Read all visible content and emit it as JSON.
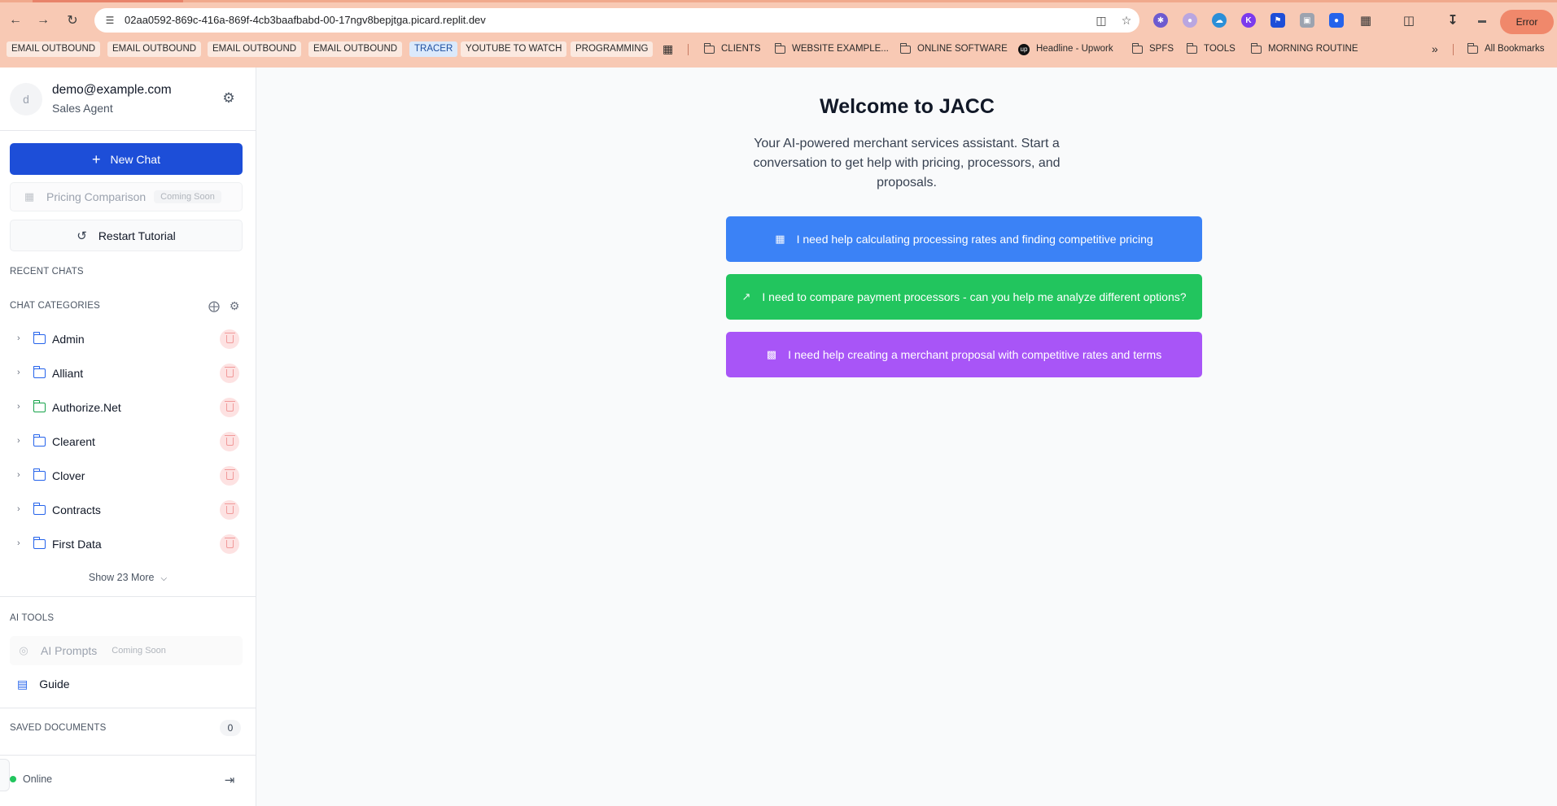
{
  "browser": {
    "url": "02aa0592-869c-416a-869f-4cb3baafbabd-00-17ngv8bepjtga.picard.replit.dev",
    "error_label": "Error",
    "bookmarks": [
      "EMAIL OUTBOUND",
      "EMAIL OUTBOUND",
      "EMAIL OUTBOUND",
      "EMAIL OUTBOUND",
      "TRACER",
      "YOUTUBE TO WATCH",
      "PROGRAMMING"
    ],
    "bookmark_folders": [
      "CLIENTS",
      "WEBSITE EXAMPLE...",
      "ONLINE SOFTWARE",
      "Headline - Upwork",
      "SPFS",
      "TOOLS",
      "MORNING ROUTINE"
    ],
    "more_label": "»",
    "all_bookmarks": "All Bookmarks"
  },
  "user": {
    "avatar_initial": "d",
    "email": "demo@example.com",
    "role": "Sales Agent"
  },
  "sidebar": {
    "new_chat": "New Chat",
    "pricing_comparison": "Pricing Comparison",
    "coming_soon": "Coming Soon",
    "restart_tutorial": "Restart Tutorial",
    "recent_chats": "RECENT CHATS",
    "chat_categories": "CHAT CATEGORIES",
    "categories": [
      {
        "name": "Admin",
        "color": "#2563eb"
      },
      {
        "name": "Alliant",
        "color": "#2563eb"
      },
      {
        "name": "Authorize.Net",
        "color": "#16a34a"
      },
      {
        "name": "Clearent",
        "color": "#2563eb"
      },
      {
        "name": "Clover",
        "color": "#2563eb"
      },
      {
        "name": "Contracts",
        "color": "#2563eb"
      },
      {
        "name": "First Data",
        "color": "#2563eb"
      }
    ],
    "show_more": "Show 23 More",
    "ai_tools": "AI TOOLS",
    "ai_prompts": "AI Prompts",
    "guide": "Guide",
    "saved_documents": "SAVED DOCUMENTS",
    "saved_count": "0",
    "status": "Online"
  },
  "main": {
    "title": "Welcome to JACC",
    "tagline": "Your AI-powered merchant services assistant. Start a conversation to get help with pricing, processors, and proposals.",
    "prompts": [
      {
        "label": "I need help calculating processing rates and finding competitive pricing",
        "icon": "calculator-icon",
        "color": "#3b82f6"
      },
      {
        "label": "I need to compare payment processors - can you help me analyze different options?",
        "icon": "trending-up-icon",
        "color": "#22c55e"
      },
      {
        "label": "I need help creating a merchant proposal with competitive rates and terms",
        "icon": "bar-chart-icon",
        "color": "#a855f7"
      }
    ]
  }
}
